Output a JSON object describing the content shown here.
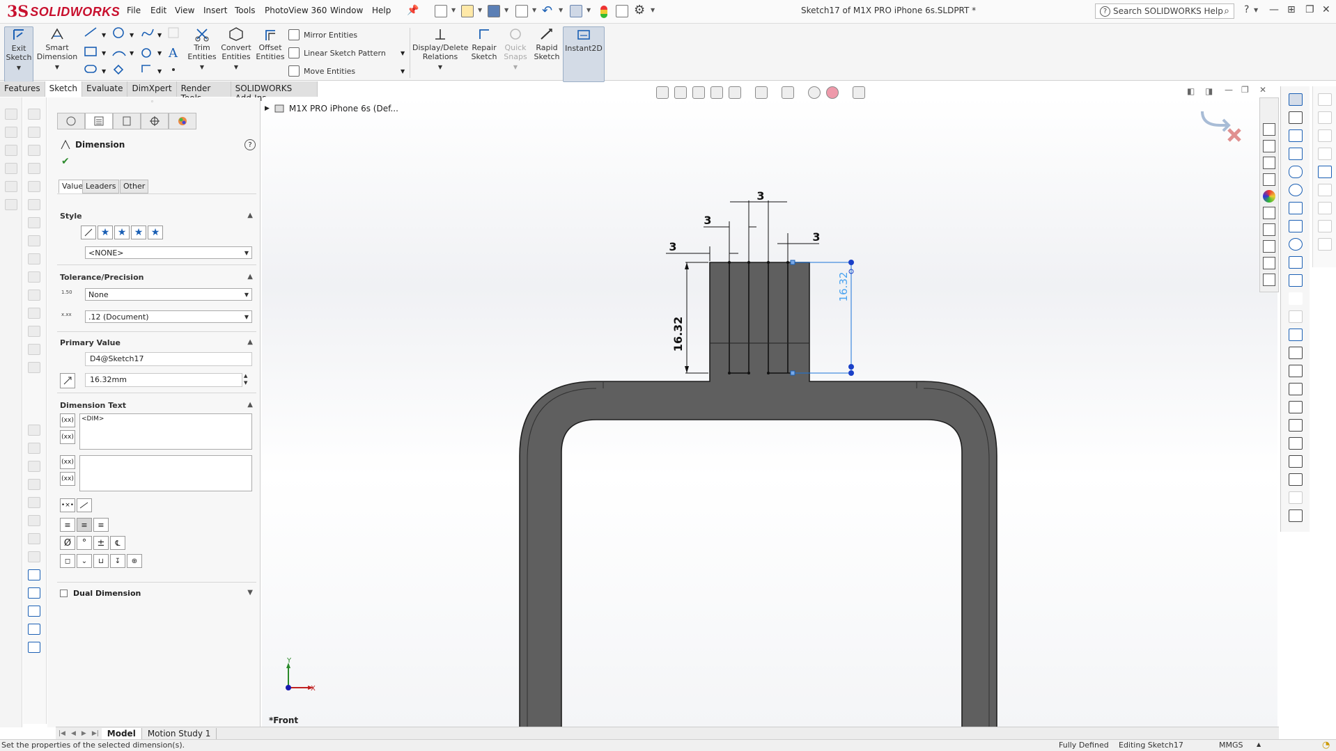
{
  "app": {
    "logo_ds": "3S",
    "logo_text": "SOLIDWORKS",
    "document_title": "Sketch17 of M1X PRO iPhone 6s.SLDPRT *",
    "search_placeholder": "Search SOLIDWORKS Help",
    "help_glyph": "?"
  },
  "menu": [
    "File",
    "Edit",
    "View",
    "Insert",
    "Tools",
    "PhotoView 360",
    "Window",
    "Help"
  ],
  "commands": {
    "exit_sketch": [
      "Exit",
      "Sketch"
    ],
    "smart_dimension": [
      "Smart",
      "Dimension"
    ],
    "trim": [
      "Trim",
      "Entities"
    ],
    "convert": [
      "Convert",
      "Entities"
    ],
    "offset": [
      "Offset",
      "Entities"
    ],
    "mirror": "Mirror Entities",
    "linear_pattern": "Linear Sketch Pattern",
    "move": "Move Entities",
    "display_delete": [
      "Display/Delete",
      "Relations"
    ],
    "repair": [
      "Repair",
      "Sketch"
    ],
    "quick_snaps": [
      "Quick",
      "Snaps"
    ],
    "rapid_sketch": [
      "Rapid",
      "Sketch"
    ],
    "instant2d": "Instant2D"
  },
  "tabs": [
    "Features",
    "Sketch",
    "Evaluate",
    "DimXpert",
    "Render Tools",
    "SOLIDWORKS Add-Ins"
  ],
  "active_tab": "Sketch",
  "property_manager": {
    "title": "Dimension",
    "help": "?",
    "subtabs": [
      "Value",
      "Leaders",
      "Other"
    ],
    "style_label": "Style",
    "style_value": "<NONE>",
    "tolerance_label": "Tolerance/Precision",
    "tolerance_type": "None",
    "precision": ".12 (Document)",
    "tol_icon_text": "1.50",
    "prec_icon_text": "x.xx",
    "primary_value_label": "Primary Value",
    "dimension_name": "D4@Sketch17",
    "dimension_value": "16.32mm",
    "dimension_text_label": "Dimension Text",
    "dim_text": "<DIM>",
    "dual_dimension_label": "Dual Dimension",
    "symbols": [
      "Ø",
      "°",
      "±"
    ]
  },
  "tree": {
    "root": "M1X PRO iPhone 6s  (Def..."
  },
  "sketch": {
    "dims": {
      "top": "3",
      "left": "3",
      "right": "3",
      "far_left": "3",
      "height": "16.32",
      "selected_height": "16.32"
    },
    "colors": {
      "part_fill": "#5c5c5c",
      "part_edge": "#2a2a2a",
      "selected": "#1a73d9",
      "selected_text": "#4aa3f0"
    }
  },
  "view_label": "*Front",
  "triad": {
    "x": "X",
    "y": "Y"
  },
  "bottom_tabs": [
    "Model",
    "Motion Study 1"
  ],
  "status": {
    "message": "Set the properties of the selected dimension(s).",
    "defined": "Fully Defined",
    "editing": "Editing Sketch17",
    "units": "MMGS"
  }
}
